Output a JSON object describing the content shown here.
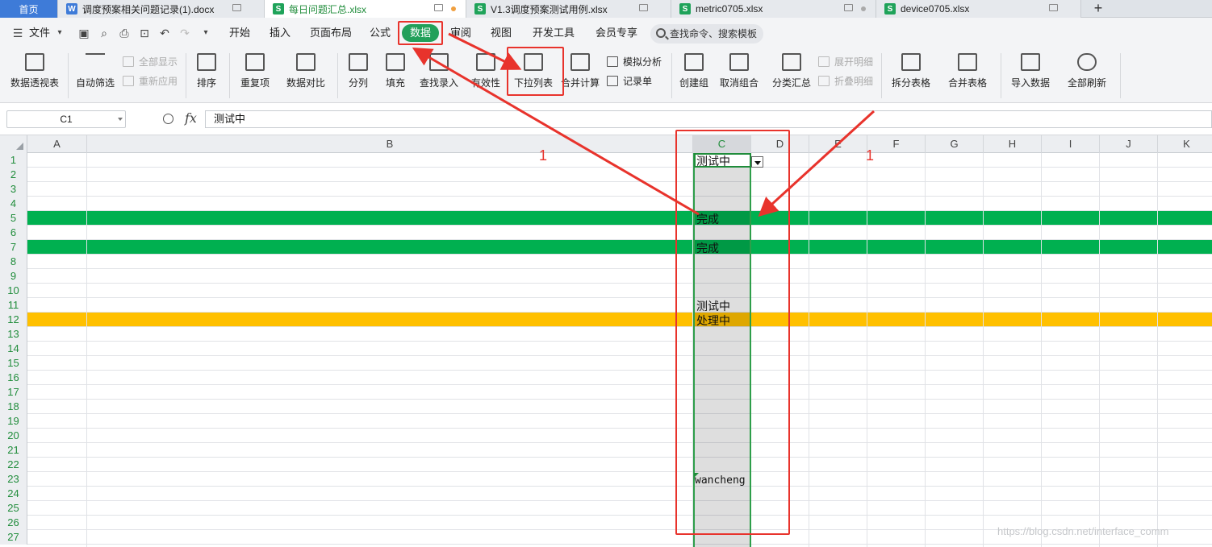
{
  "tabs": [
    {
      "label": "首页",
      "icon": "",
      "active": false
    },
    {
      "label": "调度预案相关问题记录(1).docx",
      "icon": "W",
      "icon_color": "#3e7bd8"
    },
    {
      "label": "每日问题汇总.xlsx",
      "icon": "S",
      "icon_color": "#1fa35a",
      "active": true
    },
    {
      "label": "V1.3调度预案测试用例.xlsx",
      "icon": "S",
      "icon_color": "#1fa35a"
    },
    {
      "label": "metric0705.xlsx",
      "icon": "S",
      "icon_color": "#1fa35a"
    },
    {
      "label": "device0705.xlsx",
      "icon": "S",
      "icon_color": "#1fa35a"
    }
  ],
  "add_tab": "+",
  "menu": {
    "file": "文件",
    "items": [
      "开始",
      "插入",
      "页面布局",
      "公式",
      "数据",
      "审阅",
      "视图",
      "开发工具",
      "会员专享"
    ],
    "search": "查找命令、搜索模板"
  },
  "ribbon": {
    "pivot": "数据透视表",
    "autofilter": "自动筛选",
    "show_all": "全部显示",
    "reapply": "重新应用",
    "sort": "排序",
    "duplicates": "重复项",
    "compare": "数据对比",
    "split": "分列",
    "fill": "填充",
    "lookup": "查找录入",
    "validity": "有效性",
    "dropdown": "下拉列表",
    "consolidate": "合并计算",
    "simulate": "模拟分析",
    "record": "记录单",
    "group": "创建组",
    "ungroup": "取消组合",
    "subtotal": "分类汇总",
    "expand": "展开明细",
    "collapse": "折叠明细",
    "split_table": "拆分表格",
    "merge_table": "合并表格",
    "import": "导入数据",
    "refresh_all": "全部刷新"
  },
  "formula_bar": {
    "name_box": "C1",
    "fx": "fx",
    "value": "测试中"
  },
  "columns": [
    "A",
    "B",
    "C",
    "D",
    "E",
    "F",
    "G",
    "H",
    "I",
    "J",
    "K"
  ],
  "rows": [
    "1",
    "2",
    "3",
    "4",
    "5",
    "6",
    "7",
    "8",
    "9",
    "10",
    "11",
    "12",
    "13",
    "14",
    "15",
    "16",
    "17",
    "18",
    "19",
    "20",
    "21",
    "22",
    "23",
    "24",
    "25",
    "26",
    "27"
  ],
  "cells": {
    "c1": "测试中",
    "c5": "完成",
    "c7": "完成",
    "c11": "测试中",
    "c12": "处理中",
    "c23": "wancheng"
  },
  "highlight_colors": {
    "green": "#00b050",
    "orange": "#ffc000"
  },
  "annotations": {
    "label_1": "1",
    "label_2": "1"
  },
  "watermark": "https://blog.csdn.net/interface_comm"
}
